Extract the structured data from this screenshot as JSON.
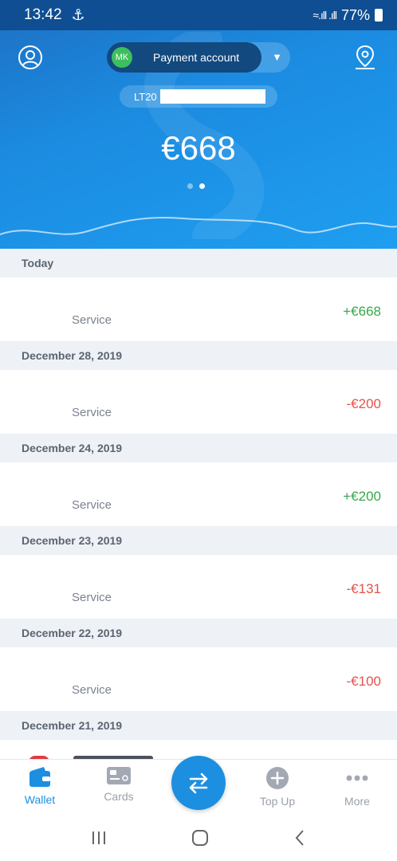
{
  "status_bar": {
    "time": "13:42",
    "battery": "77%"
  },
  "header": {
    "account_avatar_initials": "MK",
    "account_label": "Payment account",
    "iban_prefix": "LT20",
    "balance": "€668"
  },
  "transactions": [
    {
      "date": "Today",
      "description": "Service",
      "amount": "+€668",
      "direction": "in"
    },
    {
      "date": "December 28, 2019",
      "description": "Service",
      "amount": "-€200",
      "direction": "out"
    },
    {
      "date": "December 24, 2019",
      "description": "Service",
      "amount": "+€200",
      "direction": "in"
    },
    {
      "date": "December 23, 2019",
      "description": "Service",
      "amount": "-€131",
      "direction": "out"
    },
    {
      "date": "December 22, 2019",
      "description": "Service",
      "amount": "-€100",
      "direction": "out"
    },
    {
      "date": "December 21, 2019"
    }
  ],
  "tabs": {
    "wallet": "Wallet",
    "cards": "Cards",
    "topup": "Top Up",
    "more": "More"
  },
  "colors": {
    "brand": "#1d8fe0",
    "positive": "#36a84a",
    "negative": "#e5534b"
  },
  "icons": [
    "profile-icon",
    "location-pin-icon",
    "wallet-icon",
    "card-icon",
    "transfer-icon",
    "plus-circle-icon",
    "more-dots-icon"
  ]
}
